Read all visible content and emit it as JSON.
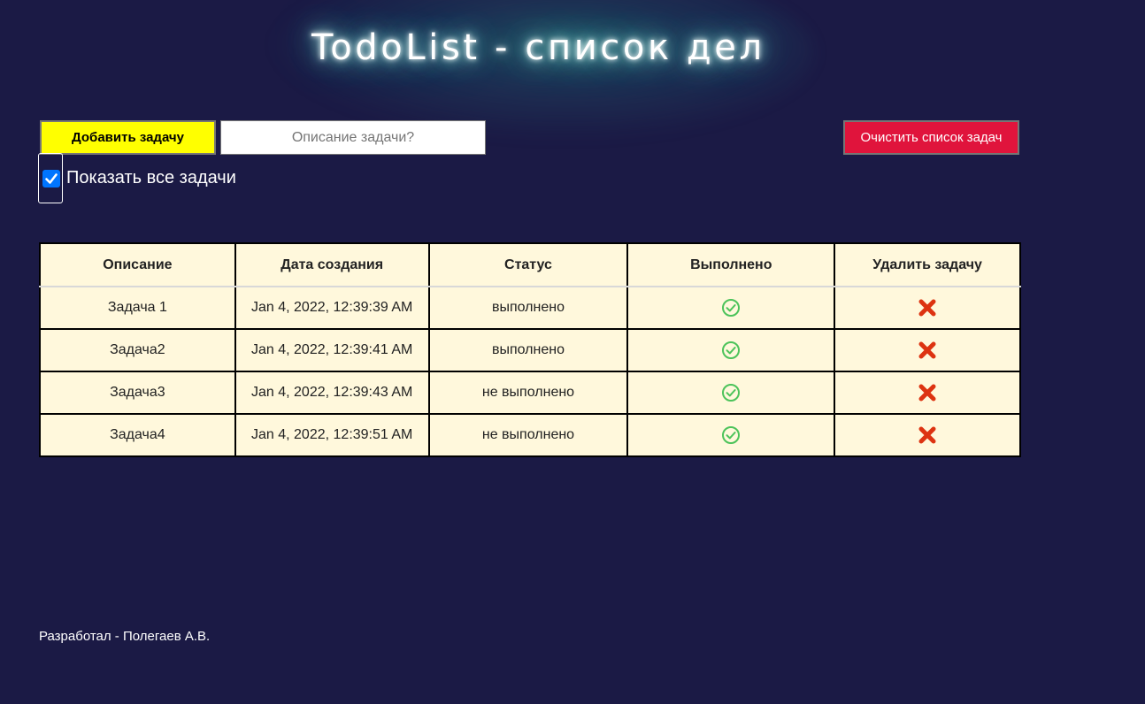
{
  "header": {
    "title": "TodoList - список дел"
  },
  "toolbar": {
    "add_label": "Добавить задачу",
    "input_value": "",
    "input_placeholder": "Описание задачи?",
    "clear_label": "Очистить список задач"
  },
  "filter": {
    "show_all_label": "Показать все задачи",
    "show_all_checked": true
  },
  "table": {
    "headers": [
      "Описание",
      "Дата создания",
      "Статус",
      "Выполнено",
      "Удалить задачу"
    ],
    "rows": [
      {
        "description": "Задача 1",
        "created": "Jan 4, 2022, 12:39:39 AM",
        "status": "выполнено"
      },
      {
        "description": "Задача2",
        "created": "Jan 4, 2022, 12:39:41 AM",
        "status": "выполнено"
      },
      {
        "description": "Задача3",
        "created": "Jan 4, 2022, 12:39:43 AM",
        "status": "не выполнено"
      },
      {
        "description": "Задача4",
        "created": "Jan 4, 2022, 12:39:51 AM",
        "status": "не выполнено"
      }
    ],
    "done_icon": "check-circle-icon",
    "delete_icon": "cross-mark-icon"
  },
  "footer": {
    "text": "Разработал - Полегаев А.В."
  },
  "colors": {
    "background": "#1b1a45",
    "add_button": "#ffff00",
    "clear_button": "#e0143c",
    "table_background": "#fff8dc",
    "done_icon": "#4cc35a",
    "delete_icon": "#dd3311",
    "checkbox": "#0075ff"
  }
}
